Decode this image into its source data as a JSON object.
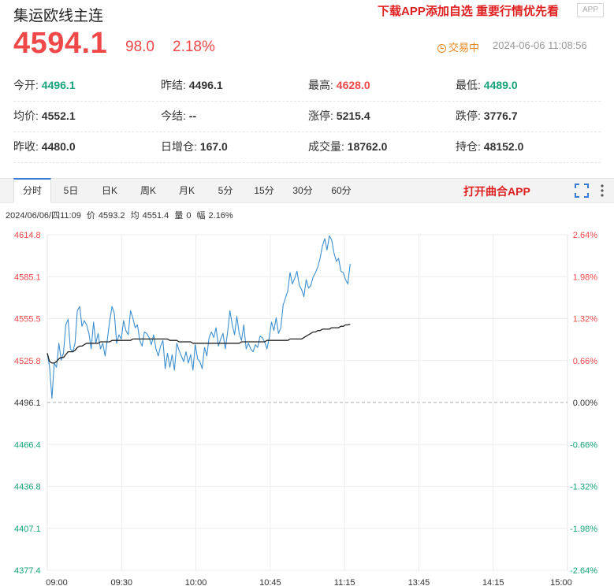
{
  "header": {
    "title": "集运欧线主连",
    "promo": "下载APP添加自选 重要行情优先看",
    "app_badge": "APP",
    "price": "4594.1",
    "change": "98.0",
    "change_pct": "2.18%",
    "status": "交易中",
    "datetime": "2024-06-06 11:08:56",
    "status_icon": "clock-icon"
  },
  "stats": [
    [
      {
        "label": "今开:",
        "value": "4496.1",
        "color": "green"
      },
      {
        "label": "昨结:",
        "value": "4496.1",
        "color": "black"
      },
      {
        "label": "最高:",
        "value": "4628.0",
        "color": "red"
      },
      {
        "label": "最低:",
        "value": "4489.0",
        "color": "green"
      }
    ],
    [
      {
        "label": "均价:",
        "value": "4552.1",
        "color": "black"
      },
      {
        "label": "今结:",
        "value": "--",
        "color": "black"
      },
      {
        "label": "涨停:",
        "value": "5215.4",
        "color": "black"
      },
      {
        "label": "跌停:",
        "value": "3776.7",
        "color": "black"
      }
    ],
    [
      {
        "label": "昨收:",
        "value": "4480.0",
        "color": "black"
      },
      {
        "label": "日增仓:",
        "value": "167.0",
        "color": "black"
      },
      {
        "label": "成交量:",
        "value": "18762.0",
        "color": "black"
      },
      {
        "label": "持仓:",
        "value": "48152.0",
        "color": "black"
      }
    ]
  ],
  "tabs": [
    "分时",
    "5日",
    "日K",
    "周K",
    "月K",
    "5分",
    "15分",
    "30分",
    "60分"
  ],
  "active_tab": "分时",
  "open_app": "打开曲合APP",
  "toolbar_icons": [
    "fullscreen-icon",
    "more-vertical-icon"
  ],
  "info": {
    "datetime": "2024/06/06/四11:09",
    "price_label": "价",
    "price": "4593.2",
    "avg_label": "均",
    "avg": "4551.4",
    "vol_label": "量",
    "vol": "0",
    "amp_label": "幅",
    "amp": "2.16%"
  },
  "colors": {
    "up": "#f04848",
    "down": "#16a37b",
    "price_line": "#3d8fcf",
    "avg_line": "#222222"
  },
  "chart_data": {
    "type": "line",
    "title": "",
    "xlabel": "",
    "ylabel": "",
    "ylim": [
      4377.4,
      4614.8
    ],
    "base": 4496.1,
    "y_ticks": [
      "4614.8",
      "4585.1",
      "4555.5",
      "4525.8",
      "4496.1",
      "4466.4",
      "4436.8",
      "4407.1",
      "4377.4"
    ],
    "y_ticks_pct": [
      "2.64%",
      "1.98%",
      "1.32%",
      "0.66%",
      "0.00%",
      "-0.66%",
      "-1.32%",
      "-1.98%",
      "-2.64%"
    ],
    "x_ticks": [
      "09:00",
      "09:30",
      "10:00",
      "10:45",
      "11:15",
      "13:45",
      "14:15",
      "15:00"
    ],
    "total_minutes": 225,
    "grid": true,
    "series": [
      {
        "values": [
          4531,
          4521,
          4499,
          4524,
          4521,
          4538,
          4526,
          4531,
          4551,
          4555,
          4534,
          4532,
          4538,
          4561,
          4564,
          4550,
          4554,
          4551,
          4545,
          4534,
          4553,
          4538,
          4545,
          4534,
          4538,
          4529,
          4541,
          4554,
          4564,
          4559,
          4538,
          4544,
          4541,
          4554,
          4547,
          4544,
          4561,
          4556,
          4549,
          4551,
          4540,
          4536,
          4546,
          4545,
          4542,
          4537,
          4544,
          4534,
          4529,
          4536,
          4540,
          4520,
          4531,
          4521,
          4530,
          4519,
          4538,
          4533,
          4529,
          4525,
          4532,
          4524,
          4530,
          4519,
          4537,
          4527,
          4525,
          4520,
          4535,
          4529,
          4542,
          4546,
          4542,
          4549,
          4536,
          4541,
          4545,
          4534,
          4546,
          4561,
          4551,
          4544,
          4557,
          4545,
          4540,
          4551,
          4534,
          4538,
          4534,
          4532,
          4537,
          4535,
          4543,
          4542,
          4539,
          4534,
          4542,
          4553,
          4547,
          4556,
          4545,
          4549,
          4565,
          4570,
          4575,
          4588,
          4580,
          4584,
          4589,
          4579,
          4576,
          4571,
          4583,
          4577,
          4579,
          4585,
          4588,
          4592,
          4598,
          4607,
          4612,
          4604,
          4614,
          4611,
          4602,
          4596,
          4598,
          4589,
          4588,
          4583,
          4580,
          4594.1
        ]
      },
      {
        "values": [
          4531,
          4525,
          4524,
          4524,
          4525,
          4527,
          4528,
          4528,
          4530,
          4532,
          4532,
          4532,
          4533,
          4535,
          4536,
          4536,
          4537,
          4538,
          4538,
          4538,
          4538,
          4538,
          4538,
          4539,
          4539,
          4539,
          4539,
          4539,
          4540,
          4540,
          4540,
          4540,
          4540,
          4540,
          4540,
          4540,
          4540,
          4541,
          4541,
          4541,
          4541,
          4541,
          4541,
          4541,
          4541,
          4541,
          4541,
          4541,
          4541,
          4541,
          4541,
          4541,
          4541,
          4540,
          4540,
          4540,
          4540,
          4539,
          4539,
          4539,
          4539,
          4539,
          4539,
          4538,
          4538,
          4538,
          4538,
          4538,
          4538,
          4538,
          4538,
          4538,
          4538,
          4538,
          4538,
          4538,
          4538,
          4538,
          4538,
          4538,
          4538,
          4538,
          4538,
          4538,
          4539,
          4539,
          4539,
          4539,
          4539,
          4539,
          4539,
          4539,
          4539,
          4539,
          4539,
          4540,
          4540,
          4540,
          4540,
          4540,
          4540,
          4540,
          4540,
          4540,
          4540,
          4541,
          4541,
          4541,
          4541,
          4541,
          4541,
          4542,
          4543,
          4544,
          4545,
          4546,
          4546,
          4547,
          4547,
          4548,
          4548,
          4548,
          4548,
          4549,
          4549,
          4549,
          4549,
          4550,
          4550,
          4551,
          4551,
          4551.4
        ]
      }
    ]
  }
}
